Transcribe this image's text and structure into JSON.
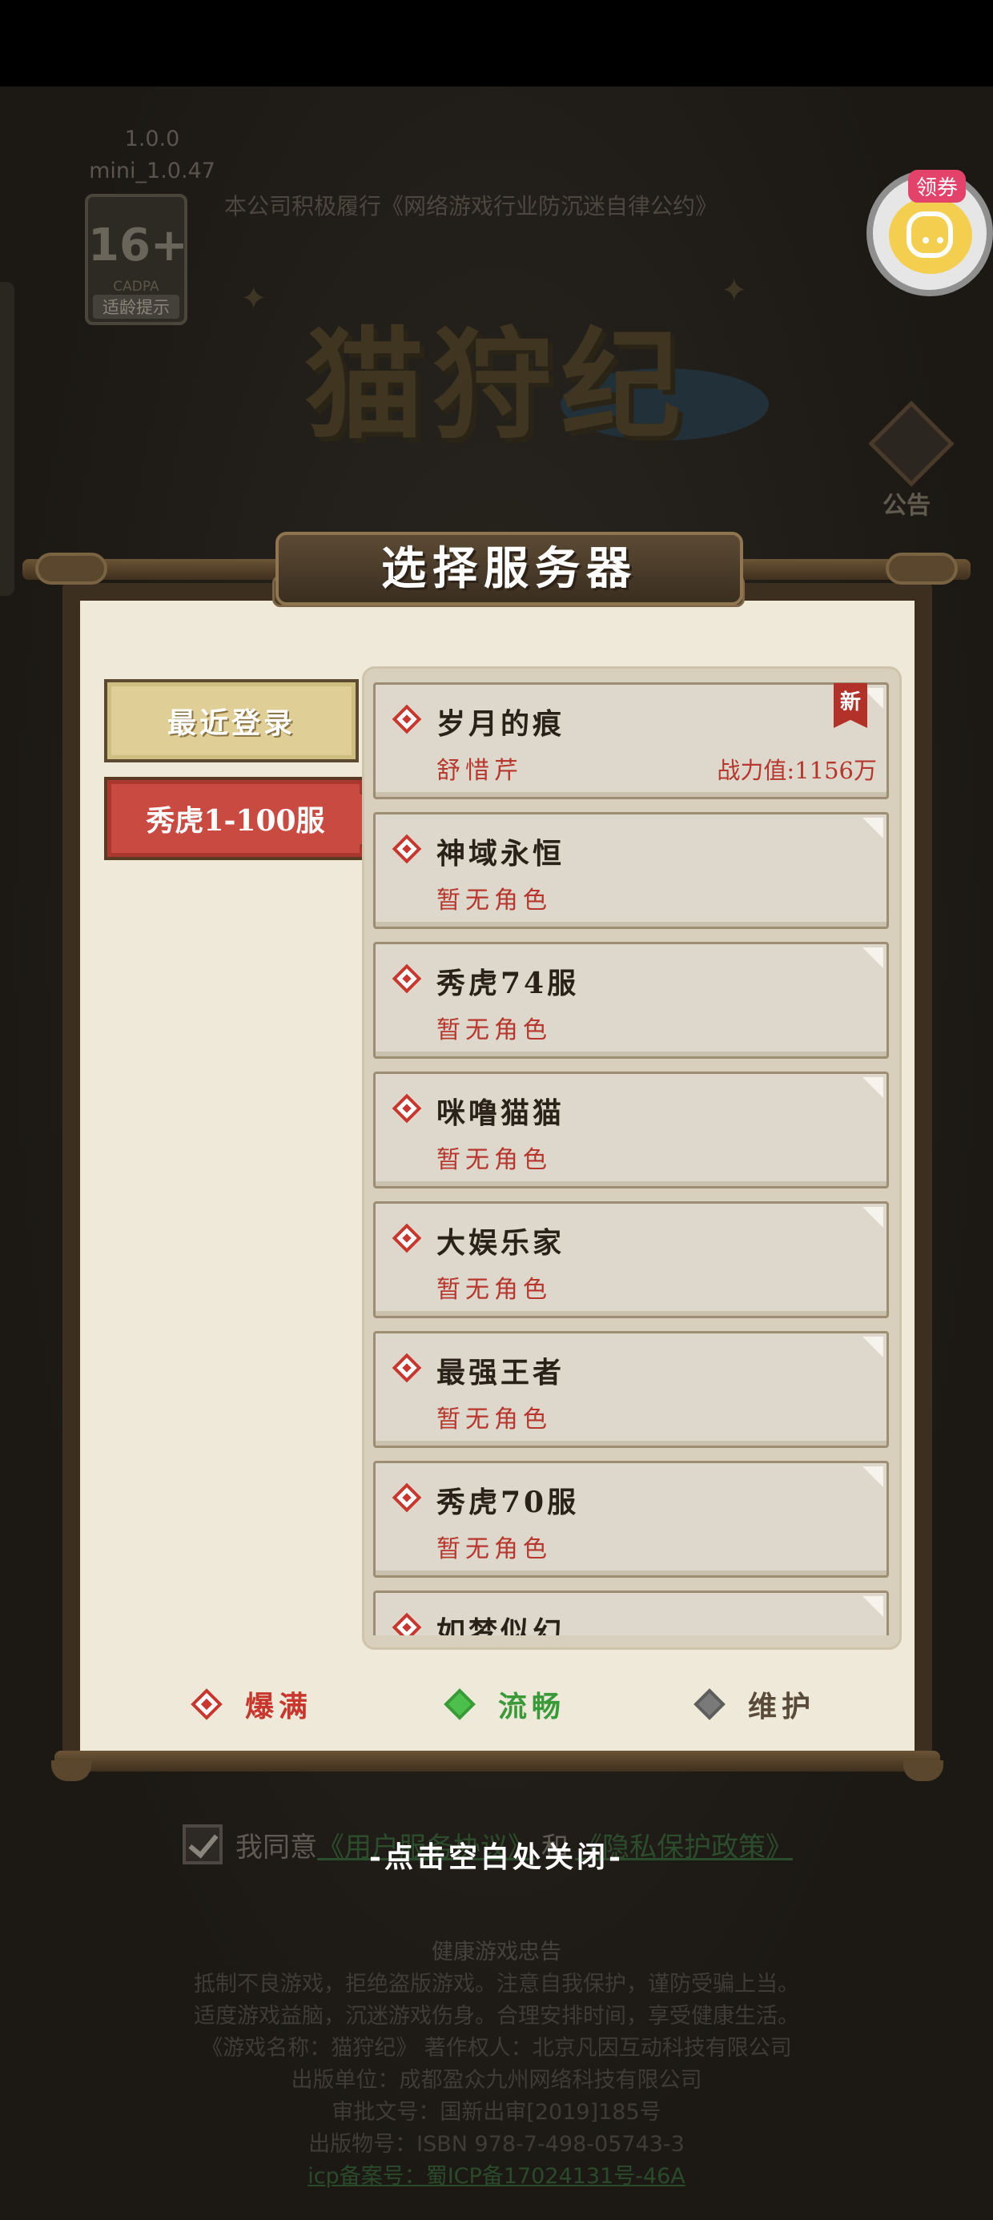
{
  "background": {
    "version": "1.0.0",
    "build": "mini_1.0.47",
    "notice": "本公司积极履行《网络游戏行业防沉迷自律公约》",
    "age_rating": {
      "number": "16+",
      "org": "CADPA",
      "tip": "适龄提示"
    },
    "logo_text": "猫狩纪",
    "coupon_label": "领券",
    "announcement_label": "公告",
    "agreement": {
      "prefix": "我同意",
      "user_link": "《用户服务协议》",
      "and": "和",
      "privacy_link": "《隐私保护政策》"
    },
    "health": {
      "title": "健康游戏忠告",
      "lines": [
        "抵制不良游戏，拒绝盗版游戏。注意自我保护，谨防受骗上当。",
        "适度游戏益脑，沉迷游戏伤身。合理安排时间，享受健康生活。",
        "《游戏名称：猫狩纪》 著作权人：北京凡因互动科技有限公司",
        "出版单位：成都盈众九州网络科技有限公司",
        "审批文号：国新出审[2019]185号",
        "出版物号：ISBN 978-7-498-05743-3"
      ],
      "icp": "icp备案号：蜀ICP备17024131号-46A"
    }
  },
  "modal": {
    "title": "选择服务器",
    "tabs": [
      {
        "label": "最近登录",
        "selected": false
      },
      {
        "label": "秀虎1-100服",
        "selected": true
      }
    ],
    "servers": [
      {
        "name": "岁月的痕",
        "role": "舒惜芹",
        "power": "战力值:1156万",
        "badge": "新",
        "status": "full"
      },
      {
        "name": "神域永恒",
        "role": "暂无角色",
        "status": "full"
      },
      {
        "name": "秀虎74服",
        "role": "暂无角色",
        "status": "full"
      },
      {
        "name": "咪噜猫猫",
        "role": "暂无角色",
        "status": "full"
      },
      {
        "name": "大娱乐家",
        "role": "暂无角色",
        "status": "full"
      },
      {
        "name": "最强王者",
        "role": "暂无角色",
        "status": "full"
      },
      {
        "name": "秀虎70服",
        "role": "暂无角色",
        "status": "full"
      },
      {
        "name": "如梦似幻",
        "role": "",
        "status": "full"
      }
    ],
    "legend": [
      {
        "label": "爆满",
        "color": "#c8362d"
      },
      {
        "label": "流畅",
        "color": "#3a9a3a"
      },
      {
        "label": "维护",
        "color": "#6a6a6a"
      }
    ],
    "close_hint": "-点击空白处关闭-"
  }
}
